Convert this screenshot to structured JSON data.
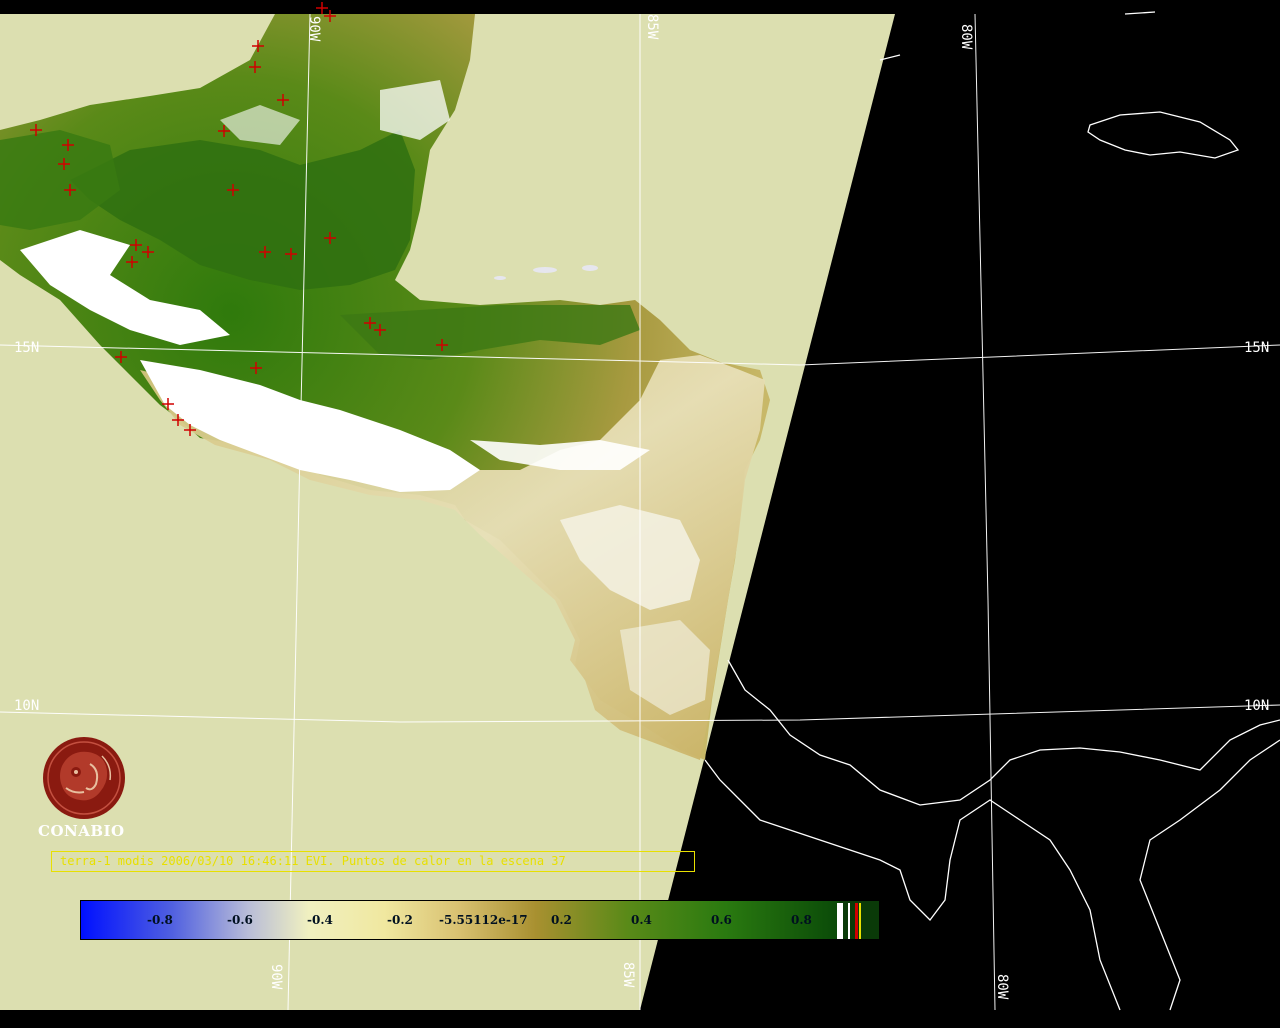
{
  "map": {
    "graticule_labels": {
      "lat_15_left": "15N",
      "lat_15_right": "15N",
      "lat_10_left": "10N",
      "lat_10_right": "10N",
      "lon_90_top": "90W",
      "lon_85_top": "85W",
      "lon_80_top": "80W",
      "lon_90_bottom": "90W",
      "lon_85_bottom": "85W",
      "lon_80_bottom": "80W"
    },
    "colors": {
      "ocean_in_swath": "#dcdfb0",
      "outside_swath": "#000000",
      "vegetation_dark": "#3a7a10",
      "vegetation_mid": "#8a9a30",
      "vegetation_light": "#c8b860",
      "cloud_white": "#ffffff",
      "hotspot": "#d00000",
      "grid": "#ffffff",
      "coast_outline": "#ffffff"
    },
    "hotspot_count_label": "37"
  },
  "logo": {
    "name": "CONABIO",
    "color": "#8a1a10"
  },
  "caption": "terra-1 modis 2006/03/10 16:46:11 EVI. Puntos de calor en la escena 37",
  "colorbar": {
    "ticks": [
      "-0.8",
      "-0.6",
      "-0.4",
      "-0.2",
      "-5.55112e-17",
      "0.2",
      "0.4",
      "0.6",
      "0.8"
    ]
  }
}
